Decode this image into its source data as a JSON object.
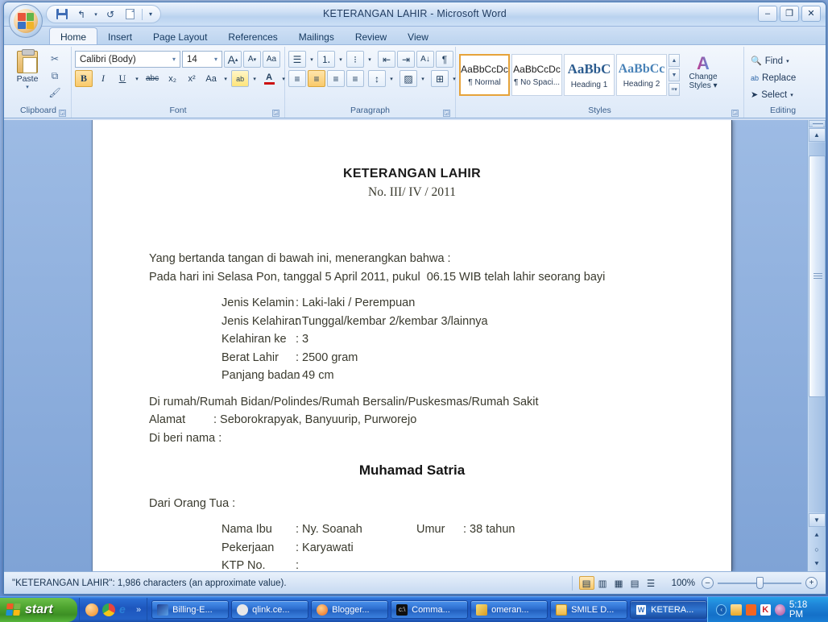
{
  "window": {
    "title": "KETERANGAN LAHIR - Microsoft Word",
    "minimize": "–",
    "maximize": "❐",
    "close": "✕"
  },
  "quick_access": {
    "save": "save-icon",
    "undo": "↰",
    "undo_caret": "▾",
    "redo": "↺",
    "new": "new-doc-icon",
    "customize": "▾"
  },
  "tabs": [
    {
      "label": "Home",
      "active": true
    },
    {
      "label": "Insert",
      "active": false
    },
    {
      "label": "Page Layout",
      "active": false
    },
    {
      "label": "References",
      "active": false
    },
    {
      "label": "Mailings",
      "active": false
    },
    {
      "label": "Review",
      "active": false
    },
    {
      "label": "View",
      "active": false
    }
  ],
  "ribbon": {
    "clipboard": {
      "label": "Clipboard",
      "paste": "Paste",
      "paste_caret": "▾",
      "cut": "✂",
      "copy": "⧉",
      "format_painter": "🖌"
    },
    "font": {
      "label": "Font",
      "font_name": "Calibri (Body)",
      "font_size": "14",
      "grow_font": "A",
      "shrink_font": "A",
      "clear_formatting": "Aa",
      "bold": "B",
      "italic": "I",
      "underline": "U",
      "strikethrough": "abc",
      "subscript": "x₂",
      "superscript": "x²",
      "change_case": "Aa",
      "highlight": "ab",
      "font_color": "A",
      "caret": "▾"
    },
    "paragraph": {
      "label": "Paragraph",
      "bullets": "☰",
      "numbering": "⒈",
      "multilevel": "⁝",
      "decrease_indent": "⇤",
      "increase_indent": "⇥",
      "sort": "A↓",
      "show_marks": "¶",
      "align_left": "≡",
      "align_center": "≡",
      "align_right": "≡",
      "justify": "≡",
      "line_spacing": "↕",
      "shading": "▨",
      "borders": "⊞"
    },
    "styles": {
      "label": "Styles",
      "items": [
        {
          "sample": "AaBbCcDc",
          "name": "¶ Normal",
          "selected": true,
          "serif": false,
          "size": "13px"
        },
        {
          "sample": "AaBbCcDc",
          "name": "¶ No Spaci...",
          "selected": false,
          "serif": false,
          "size": "13px"
        },
        {
          "sample": "AaBbC",
          "name": "Heading 1",
          "selected": false,
          "serif": true,
          "size": "17px"
        },
        {
          "sample": "AaBbCc",
          "name": "Heading 2",
          "selected": false,
          "serif": true,
          "size": "16px"
        }
      ],
      "nav_up": "▲",
      "nav_down": "▼",
      "nav_more": "▾",
      "change_styles": "Change\nStyles ▾"
    },
    "editing": {
      "label": "Editing",
      "find": "Find",
      "replace": "Replace",
      "select": "Select",
      "caret": "▾"
    }
  },
  "document": {
    "title": "KETERANGAN LAHIR",
    "subtitle": "No. III/ IV / 2011",
    "intro_1": "Yang bertanda tangan di bawah ini, menerangkan bahwa :",
    "intro_2": "Pada hari ini Selasa Pon, tanggal 5 April 2011, pukul  06.15 WIB telah lahir seorang bayi",
    "fields": [
      {
        "key": "Jenis Kelamin",
        "value": ": Laki-laki / Perempuan"
      },
      {
        "key": "Jenis Kelahiran",
        "value": ": Tunggal/kembar 2/kembar 3/lainnya"
      },
      {
        "key": "Kelahiran ke",
        "value": ": 3"
      },
      {
        "key": "Berat Lahir",
        "value": ": 2500 gram"
      },
      {
        "key": "Panjang badan",
        "value": ": 49 cm"
      }
    ],
    "place_line": "Di rumah/Rumah Bidan/Polindes/Rumah Bersalin/Puskesmas/Rumah Sakit",
    "address_key": "Alamat",
    "address_value": ": Seborokrapyak, Banyuurip, Purworejo",
    "named_label": "Di beri nama :",
    "baby_name": "Muhamad Satria",
    "parents_label": "Dari Orang Tua :",
    "parents": [
      {
        "key": "Nama Ibu",
        "value": ": Ny. Soanah",
        "extra_key": "Umur",
        "extra_value": ": 38 tahun"
      },
      {
        "key": "Pekerjaan",
        "value": ": Karyawati",
        "extra_key": "",
        "extra_value": ""
      },
      {
        "key": "KTP No.",
        "value": ":",
        "extra_key": "",
        "extra_value": ""
      }
    ]
  },
  "statusbar": {
    "text": "\"KETERANGAN LAHIR\": 1,986 characters (an approximate value).",
    "views": [
      {
        "name": "print-layout-view",
        "glyph": "▤",
        "active": true
      },
      {
        "name": "full-screen-reading-view",
        "glyph": "▥",
        "active": false
      },
      {
        "name": "web-layout-view",
        "glyph": "▦",
        "active": false
      },
      {
        "name": "outline-view",
        "glyph": "▤",
        "active": false
      },
      {
        "name": "draft-view",
        "glyph": "☰",
        "active": false
      }
    ],
    "zoom": "100%",
    "zoom_out": "–",
    "zoom_in": "+"
  },
  "scrollbar": {
    "split": "split-bar",
    "up": "▲",
    "down": "▼",
    "previous_page": "⌃",
    "browse_object": "○",
    "next_page": "⌄"
  },
  "taskbar": {
    "start": "start",
    "quick_launch": [
      "show-desktop-icon",
      "chrome-icon",
      "internet-explorer-icon"
    ],
    "quick_launch_more": "»",
    "tasks": [
      {
        "label": "Billing-E...",
        "icon_color": "#1f3f8f",
        "active": false
      },
      {
        "label": "qlink.ce...",
        "icon_color": "#e8e8e8",
        "active": false
      },
      {
        "label": "Blogger...",
        "icon_color": "#f08a1c",
        "active": false
      },
      {
        "label": "Comma...",
        "icon_color": "#101010",
        "active": false
      },
      {
        "label": "omeran...",
        "icon_color": "#f0c020",
        "active": false
      },
      {
        "label": "SMILE D...",
        "icon_color": "#f3c551",
        "active": false
      },
      {
        "label": "KETERA...",
        "icon_color": "#2d6cc0",
        "active": true
      }
    ],
    "tray_chevron": "‹",
    "tray_icons": [
      {
        "name": "mail-icon",
        "color": "#f3b342"
      },
      {
        "name": "norton-icon",
        "color": "#f26522"
      },
      {
        "name": "kaspersky-icon",
        "color": "#cf2027"
      },
      {
        "name": "messenger-icon",
        "color": "#c06ab0"
      }
    ],
    "clock": "5:18 PM"
  },
  "colors": {
    "accent": "#f7c96d",
    "title_blue": "#1f3a5f",
    "taskbar_blue": "#1d56bd",
    "doc_text": "#3a3a2e"
  }
}
